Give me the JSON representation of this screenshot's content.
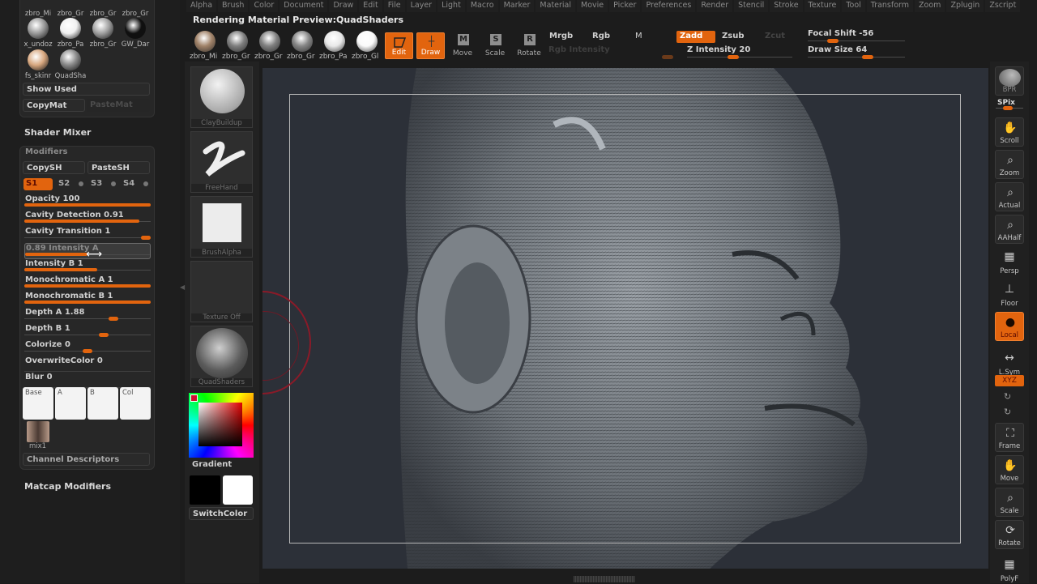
{
  "menu": [
    "Alpha",
    "Brush",
    "Color",
    "Document",
    "Draw",
    "Edit",
    "File",
    "Layer",
    "Light",
    "Macro",
    "Marker",
    "Material",
    "Movie",
    "Picker",
    "Preferences",
    "Render",
    "Stencil",
    "Stroke",
    "Texture",
    "Tool",
    "Transform",
    "Zoom",
    "Zplugin",
    "Zscript"
  ],
  "status_title": "Rendering Material Preview:QuadShaders",
  "left_panel": {
    "materials": [
      {
        "label": "zbro_Mi",
        "color": "#b08a70"
      },
      {
        "label": "zbro_Gr",
        "color": "#8a8a8a"
      },
      {
        "label": "zbro_Gr",
        "color": "#8c8c8c"
      },
      {
        "label": "zbro_Gr",
        "color": "#909090"
      },
      {
        "label": "x_undoz",
        "color": "#9a9a9a"
      },
      {
        "label": "zbro_Pa",
        "color": "#f0f0f0"
      },
      {
        "label": "zbro_Gr",
        "color": "#a0a0a0"
      },
      {
        "label": "GW_Dar",
        "color": "#101010"
      },
      {
        "label": "fs_skinr",
        "color": "#d8a880"
      },
      {
        "label": "QuadSha",
        "color": "#888888"
      }
    ],
    "show_used": "Show Used",
    "copy_mat": "CopyMat",
    "paste_mat": "PasteMat",
    "shader_mixer": "Shader Mixer",
    "modifiers": "Modifiers",
    "copy_sh": "CopySH",
    "paste_sh": "PasteSH",
    "shader_slots": [
      "S1",
      "S2",
      "S3",
      "S4"
    ],
    "active_slot": "S1",
    "sliders": [
      {
        "label": "Opacity 100",
        "value": 1.0,
        "style": "fill"
      },
      {
        "label": "Cavity Detection 0.91",
        "value": 0.91,
        "style": "fill"
      },
      {
        "label": "Cavity Transition 1",
        "value": 1.0,
        "style": "knob"
      },
      {
        "label": "0.89 Intensity A",
        "value": 0.5,
        "style": "fill",
        "active": true
      },
      {
        "label": "Intensity B 1",
        "value": 0.58,
        "style": "fill"
      },
      {
        "label": "Monochromatic A 1",
        "value": 1.0,
        "style": "fill"
      },
      {
        "label": "Monochromatic B 1",
        "value": 1.0,
        "style": "fill"
      },
      {
        "label": "Depth A 1.88",
        "value": 0.72,
        "style": "knob"
      },
      {
        "label": "Depth B 1",
        "value": 0.64,
        "style": "knob"
      },
      {
        "label": "Colorize 0",
        "value": 0.5,
        "style": "knob"
      },
      {
        "label": "OverwriteColor 0",
        "value": 0,
        "style": "none"
      },
      {
        "label": "Blur 0",
        "value": 0,
        "style": "none"
      }
    ],
    "channels": [
      "Base",
      "A",
      "B",
      "Col"
    ],
    "mix_label": "mix1",
    "channel_descriptors": "Channel Descriptors",
    "matcap_modifiers": "Matcap Modifiers"
  },
  "brush_column": {
    "tiles": [
      "ClayBuildup",
      "FreeHand",
      "BrushAlpha",
      "Texture Off",
      "QuadShaders"
    ],
    "gradient": "Gradient",
    "switch_color": "SwitchColor",
    "main_color": "#000000",
    "secondary_color": "#ffffff"
  },
  "toolbar": {
    "materials": [
      {
        "label": "zbro_Mi",
        "color": "#a08268"
      },
      {
        "label": "zbro_Gr",
        "color": "#7e7e7e"
      },
      {
        "label": "zbro_Gr",
        "color": "#808080"
      },
      {
        "label": "zbro_Gr",
        "color": "#858585"
      },
      {
        "label": "zbro_Pa",
        "color": "#e8e8e8"
      },
      {
        "label": "zbro_Gl",
        "color": "#fafafa"
      }
    ],
    "edit": "Edit",
    "draw": "Draw",
    "move": "Move",
    "scale": "Scale",
    "rotate": "Rotate",
    "mrgb": "Mrgb",
    "rgb": "Rgb",
    "m": "M",
    "zadd": "Zadd",
    "zsub": "Zsub",
    "zcut": "Zcut",
    "rgb_intensity": "Rgb Intensity",
    "z_intensity": {
      "label": "Z Intensity 20",
      "value": 20
    },
    "focal_shift": {
      "label": "Focal Shift -56",
      "value": -56
    },
    "draw_size": {
      "label": "Draw Size 64",
      "value": 64
    }
  },
  "right_tray": {
    "bpr": "BPR",
    "spix": "SPix",
    "buttons": [
      {
        "label": "Scroll",
        "icon": "hand-icon",
        "on": false
      },
      {
        "label": "Zoom",
        "icon": "magnifier-icon",
        "on": false
      },
      {
        "label": "Actual",
        "icon": "magnifier-icon",
        "on": false
      },
      {
        "label": "AAHalf",
        "icon": "magnifier-icon",
        "on": false
      },
      {
        "label": "Persp",
        "icon": "grid-icon",
        "on": false
      },
      {
        "label": "Floor",
        "icon": "floor-icon",
        "on": false
      },
      {
        "label": "Local",
        "icon": "local-icon",
        "on": true
      },
      {
        "label": "L.Sym",
        "icon": "symmetry-icon",
        "on": false
      }
    ],
    "xyz": "XYZ",
    "buttons2": [
      {
        "label": "Frame",
        "icon": "frame-icon"
      },
      {
        "label": "Move",
        "icon": "hand-icon"
      },
      {
        "label": "Scale",
        "icon": "magnifier-icon"
      },
      {
        "label": "Rotate",
        "icon": "rotate-icon"
      },
      {
        "label": "PolyF",
        "icon": "polyframe-icon"
      }
    ]
  },
  "colors": {
    "accent": "#e2640e",
    "canvas_bg": "#2c3038",
    "panel_bg": "#272727"
  }
}
